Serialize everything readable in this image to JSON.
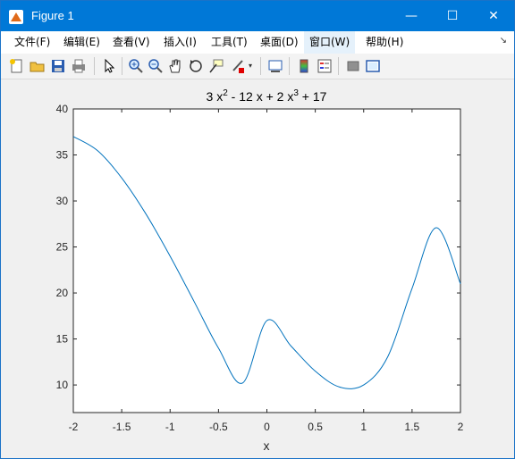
{
  "window": {
    "title": "Figure 1",
    "minimize_glyph": "—",
    "maximize_glyph": "☐",
    "close_glyph": "✕"
  },
  "menu": {
    "items": [
      "文件(F)",
      "编辑(E)",
      "查看(V)",
      "插入(I)",
      "工具(T)",
      "桌面(D)",
      "窗口(W)",
      "帮助(H)"
    ],
    "active_index": 6,
    "overflow_glyph": "↘"
  },
  "toolbar": {
    "buttons": [
      "new-figure-icon",
      "open-file-icon",
      "save-icon",
      "print-icon",
      "pointer-icon",
      "zoom-in-icon",
      "zoom-out-icon",
      "pan-hand-icon",
      "rotate-3d-icon",
      "data-cursor-icon",
      "brush-icon",
      "brush-dropdown-icon",
      "link-plot-icon",
      "colorbar-icon",
      "legend-icon",
      "hide-plot-tools-icon",
      "show-plot-tools-icon"
    ]
  },
  "chart_data": {
    "type": "line",
    "title": "3 x^2 - 12 x + 2 x^3 + 17",
    "title_parts": {
      "t1": "3 x",
      "s1": "2",
      "t2": " - 12 x + 2 x",
      "s2": "3",
      "t3": " + 17"
    },
    "xlabel": "x",
    "ylabel": "",
    "xlim": [
      -2,
      2
    ],
    "ylim": [
      7,
      40
    ],
    "xticks": [
      -2,
      -1.5,
      -1,
      -0.5,
      0,
      0.5,
      1,
      1.5,
      2
    ],
    "yticks": [
      10,
      15,
      20,
      25,
      30,
      35,
      40
    ],
    "xtick_labels": [
      "-2",
      "-1.5",
      "-1",
      "-0.5",
      "0",
      "0.5",
      "1",
      "1.5",
      "2"
    ],
    "ytick_labels": [
      "10",
      "15",
      "20",
      "25",
      "30",
      "35",
      "40"
    ],
    "grid": false,
    "line_color": "#0072bd",
    "series": [
      {
        "x": [
          -2,
          -1.75,
          -1.5,
          -1.25,
          -1,
          -0.75,
          -0.5,
          -0.25,
          0,
          0.25,
          0.5,
          0.75,
          1,
          1.25,
          1.5,
          1.75,
          2
        ],
        "y": [
          37,
          35.47,
          32.5,
          28.59,
          24,
          19.03,
          14,
          10.22,
          17,
          14.22,
          11.5,
          9.78,
          10,
          13.09,
          20.5,
          27.09,
          21
        ]
      }
    ]
  }
}
